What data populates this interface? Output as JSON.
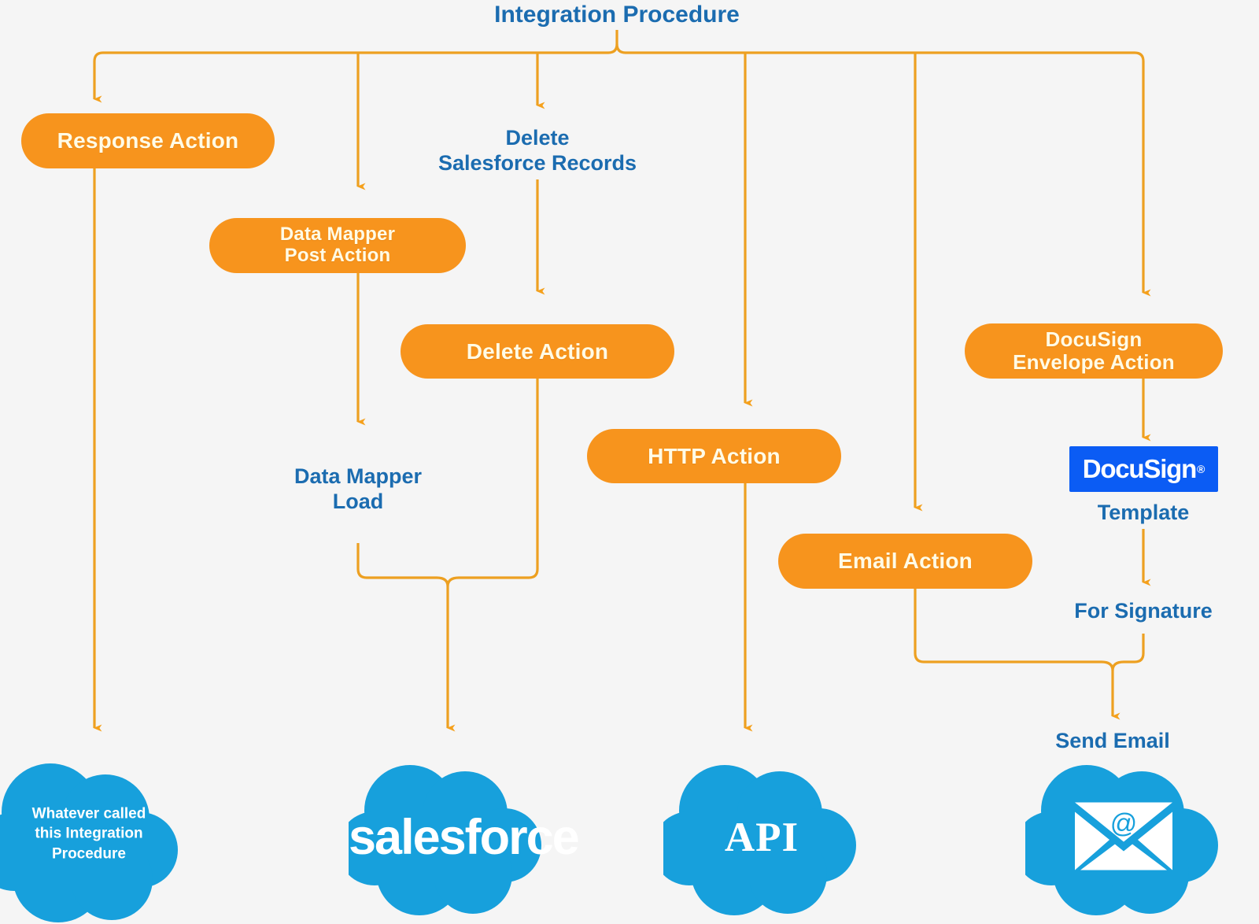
{
  "diagram": {
    "title": "Integration Procedure",
    "colors": {
      "background": "#f5f5f5",
      "action_orange": "#f7941d",
      "connector_orange": "#eda021",
      "label_blue": "#1b6cb0",
      "cloud_blue": "#17a0dc",
      "docusign_blue": "#0b5cf4",
      "action_text": "#fffbe6"
    },
    "nodes": {
      "response_action": "Response Action",
      "delete_salesforce_records": "Delete\nSalesforce Records",
      "delete_salesforce_records_line1": "Delete",
      "delete_salesforce_records_line2": "Salesforce Records",
      "data_mapper_post_action_line1": "Data Mapper",
      "data_mapper_post_action_line2": "Post Action",
      "delete_action": "Delete Action",
      "data_mapper_load_line1": "Data Mapper",
      "data_mapper_load_line2": "Load",
      "http_action": "HTTP Action",
      "email_action": "Email Action",
      "docusign_envelope_action_line1": "DocuSign",
      "docusign_envelope_action_line2": "Envelope Action",
      "docusign_logo": "DocuSign",
      "docusign_logo_mark": "®",
      "template": "Template",
      "for_signature": "For Signature",
      "send_email": "Send Email"
    },
    "clouds": {
      "note_line1": "Whatever called",
      "note_line2": "this Integration",
      "note_line3": "Procedure",
      "salesforce": "salesforce",
      "api": "API",
      "email_icon": "envelope-at-icon"
    }
  }
}
